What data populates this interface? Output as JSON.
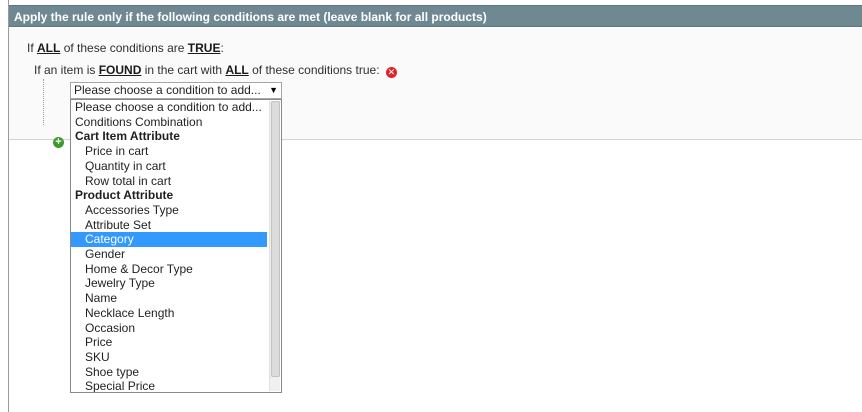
{
  "section": {
    "title": "Apply the rule only if the following conditions are met (leave blank for all products)"
  },
  "conditions": {
    "line1": {
      "prefix": "If",
      "aggregator": "ALL",
      "middle": "of these conditions are",
      "value": "TRUE",
      "suffix": ":"
    },
    "line2": {
      "prefix": "If an item is",
      "found": "FOUND",
      "middle": "in the cart with",
      "aggregator": "ALL",
      "suffix": "of these conditions true:"
    },
    "remove_icon": "remove-icon",
    "add_icon": "add-icon"
  },
  "select": {
    "selected_label": "Please choose a condition to add...",
    "arrow": "▼"
  },
  "dropdown": {
    "options": [
      {
        "label": "Please choose a condition to add...",
        "kind": "option",
        "level": 0
      },
      {
        "label": "Conditions Combination",
        "kind": "option",
        "level": 0
      },
      {
        "label": "Cart Item Attribute",
        "kind": "group"
      },
      {
        "label": "Price in cart",
        "kind": "option",
        "level": 1
      },
      {
        "label": "Quantity in cart",
        "kind": "option",
        "level": 1
      },
      {
        "label": "Row total in cart",
        "kind": "option",
        "level": 1
      },
      {
        "label": "Product Attribute",
        "kind": "group"
      },
      {
        "label": "Accessories Type",
        "kind": "option",
        "level": 1
      },
      {
        "label": "Attribute Set",
        "kind": "option",
        "level": 1
      },
      {
        "label": "Category",
        "kind": "option",
        "level": 1,
        "highlighted": true
      },
      {
        "label": "Gender",
        "kind": "option",
        "level": 1
      },
      {
        "label": "Home & Decor Type",
        "kind": "option",
        "level": 1
      },
      {
        "label": "Jewelry Type",
        "kind": "option",
        "level": 1
      },
      {
        "label": "Name",
        "kind": "option",
        "level": 1
      },
      {
        "label": "Necklace Length",
        "kind": "option",
        "level": 1
      },
      {
        "label": "Occasion",
        "kind": "option",
        "level": 1
      },
      {
        "label": "Price",
        "kind": "option",
        "level": 1
      },
      {
        "label": "SKU",
        "kind": "option",
        "level": 1
      },
      {
        "label": "Shoe type",
        "kind": "option",
        "level": 1
      },
      {
        "label": "Special Price",
        "kind": "option",
        "level": 1
      }
    ]
  },
  "colors": {
    "header_bg": "#6f8992",
    "highlight": "#3399ff",
    "remove": "#d9262c",
    "add": "#3f9a2f"
  }
}
